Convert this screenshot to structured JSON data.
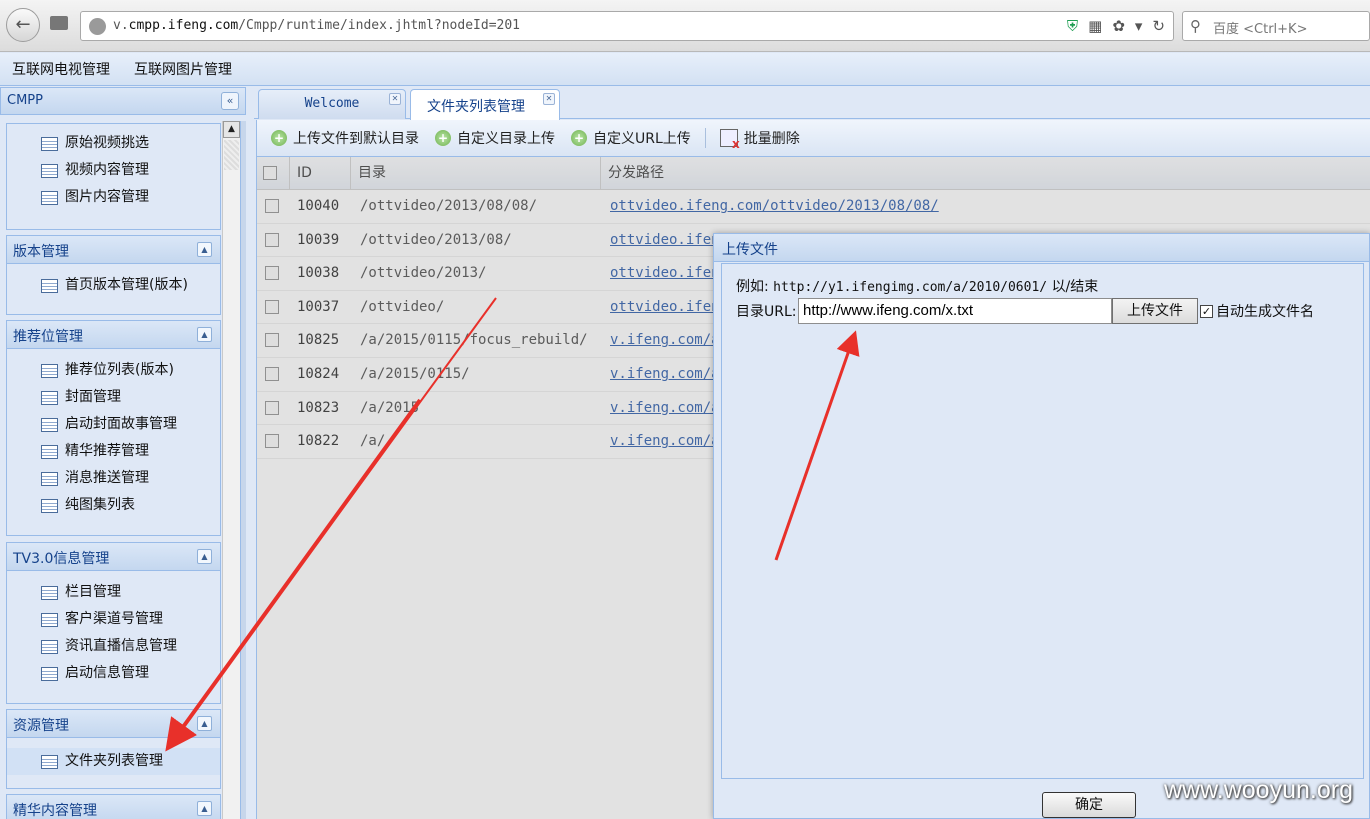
{
  "browser": {
    "url_prefix": "v.",
    "url_domain": "cmpp.ifeng.com",
    "url_path": "/Cmpp/runtime/index.jhtml?nodeId=201",
    "search_placeholder": "百度 <Ctrl+K>"
  },
  "topmenu": [
    "互联网电视管理",
    "互联网图片管理"
  ],
  "sidebar": {
    "title": "CMPP",
    "groups": [
      {
        "title": "",
        "items": [
          "原始视频挑选",
          "视频内容管理",
          "图片内容管理"
        ]
      },
      {
        "title": "版本管理",
        "items": [
          "首页版本管理(版本)"
        ]
      },
      {
        "title": "推荐位管理",
        "items": [
          "推荐位列表(版本)",
          "封面管理",
          "启动封面故事管理",
          "精华推荐管理",
          "消息推送管理",
          "纯图集列表"
        ]
      },
      {
        "title": "TV3.0信息管理",
        "items": [
          "栏目管理",
          "客户渠道号管理",
          "资讯直播信息管理",
          "启动信息管理"
        ]
      },
      {
        "title": "资源管理",
        "items": [
          "文件夹列表管理"
        ]
      },
      {
        "title": "精华内容管理",
        "items": []
      }
    ]
  },
  "tabs": [
    {
      "label": "Welcome"
    },
    {
      "label": "文件夹列表管理"
    }
  ],
  "toolbar": {
    "upload_default": "上传文件到默认目录",
    "custom_dir_upload": "自定义目录上传",
    "custom_url_upload": "自定义URL上传",
    "batch_delete": "批量删除"
  },
  "table": {
    "headers": [
      "ID",
      "目录",
      "分发路径"
    ],
    "rows": [
      {
        "id": "10040",
        "dir": "/ottvideo/2013/08/08/",
        "path": "ottvideo.ifeng.com/ottvideo/2013/08/08/"
      },
      {
        "id": "10039",
        "dir": "/ottvideo/2013/08/",
        "path": "ottvideo.ifen"
      },
      {
        "id": "10038",
        "dir": "/ottvideo/2013/",
        "path": "ottvideo.ifen"
      },
      {
        "id": "10037",
        "dir": "/ottvideo/",
        "path": "ottvideo.ifen"
      },
      {
        "id": "10825",
        "dir": "/a/2015/0115/focus_rebuild/",
        "path": "v.ifeng.com/a"
      },
      {
        "id": "10824",
        "dir": "/a/2015/0115/",
        "path": "v.ifeng.com/a"
      },
      {
        "id": "10823",
        "dir": "/a/2015",
        "path": "v.ifeng.com/a"
      },
      {
        "id": "10822",
        "dir": "/a/",
        "path": "v.ifeng.com/a"
      }
    ]
  },
  "dialog": {
    "title": "上传文件",
    "example_label": "例如:",
    "example_url": "http://y1.ifengimg.com/a/2010/0601/",
    "example_suffix": "以/结束",
    "url_label": "目录URL:",
    "url_value": "http://www.ifeng.com/x.txt",
    "upload_button": "上传文件",
    "auto_name_label": "自动生成文件名",
    "auto_name_checked": true,
    "confirm_button": "确定"
  },
  "watermark": "www.wooyun.org",
  "colors": {
    "annotation_arrow": "#e8302a",
    "link": "#2255aa",
    "panel_border": "#99bbe8"
  }
}
